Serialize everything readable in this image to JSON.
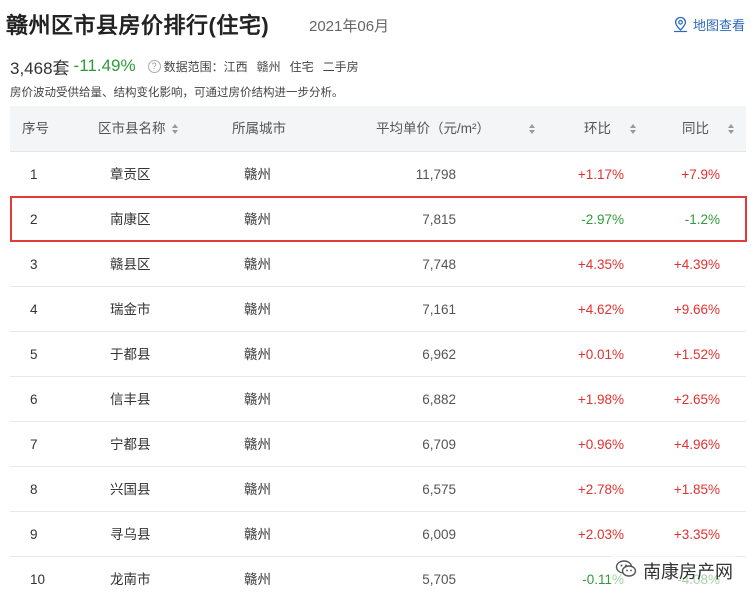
{
  "header": {
    "title": "赣州区市县房价排行(住宅)",
    "date": "2021年06月",
    "map_link": "地图查看"
  },
  "summary": {
    "count": "3,468套",
    "change": "-11.49%",
    "scope_label": "数据范围：",
    "scope": [
      "江西",
      "赣州",
      "住宅",
      "二手房"
    ]
  },
  "note": "房价波动受供给量、结构变化影响，可通过房价结构进一步分析。",
  "table": {
    "headers": [
      "序号",
      "区市县名称",
      "所属城市",
      "平均单价（元/m²）",
      "环比",
      "同比"
    ],
    "rows": [
      {
        "idx": "1",
        "name": "章贡区",
        "city": "赣州",
        "price": "11,798",
        "mom": "+1.17%",
        "yoy": "+7.9%"
      },
      {
        "idx": "2",
        "name": "南康区",
        "city": "赣州",
        "price": "7,815",
        "mom": "-2.97%",
        "yoy": "-1.2%"
      },
      {
        "idx": "3",
        "name": "赣县区",
        "city": "赣州",
        "price": "7,748",
        "mom": "+4.35%",
        "yoy": "+4.39%"
      },
      {
        "idx": "4",
        "name": "瑞金市",
        "city": "赣州",
        "price": "7,161",
        "mom": "+4.62%",
        "yoy": "+9.66%"
      },
      {
        "idx": "5",
        "name": "于都县",
        "city": "赣州",
        "price": "6,962",
        "mom": "+0.01%",
        "yoy": "+1.52%"
      },
      {
        "idx": "6",
        "name": "信丰县",
        "city": "赣州",
        "price": "6,882",
        "mom": "+1.98%",
        "yoy": "+2.65%"
      },
      {
        "idx": "7",
        "name": "宁都县",
        "city": "赣州",
        "price": "6,709",
        "mom": "+0.96%",
        "yoy": "+4.96%"
      },
      {
        "idx": "8",
        "name": "兴国县",
        "city": "赣州",
        "price": "6,575",
        "mom": "+2.78%",
        "yoy": "+1.85%"
      },
      {
        "idx": "9",
        "name": "寻乌县",
        "city": "赣州",
        "price": "6,009",
        "mom": "+2.03%",
        "yoy": "+3.35%"
      },
      {
        "idx": "10",
        "name": "龙南市",
        "city": "赣州",
        "price": "5,705",
        "mom": "-0.11%",
        "yoy": "-4.08%"
      }
    ]
  },
  "watermark": "南康房产网",
  "colors": {
    "up": "#e0322f",
    "down": "#2f9b3a",
    "highlight": "#e33a3a",
    "link": "#2c6ab8"
  }
}
